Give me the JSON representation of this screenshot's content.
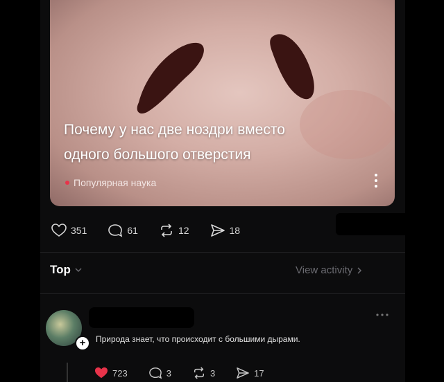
{
  "post": {
    "title_line1": "Почему у нас две ноздри вместо",
    "title_line2": "одного большого отверстия",
    "category": "Популярная наука",
    "more_icon": "vertical-dots-icon",
    "accent": "#e8334a"
  },
  "actions": {
    "likes": "351",
    "comments": "61",
    "reposts": "12",
    "shares": "18"
  },
  "comments_header": {
    "filter": "Top",
    "view_activity": "View activity"
  },
  "comment": {
    "text": "Природа знает, что происходит с большими дырами.",
    "likes": "723",
    "replies": "3",
    "reposts": "3",
    "shares": "17",
    "like_color": "#e8334a"
  }
}
